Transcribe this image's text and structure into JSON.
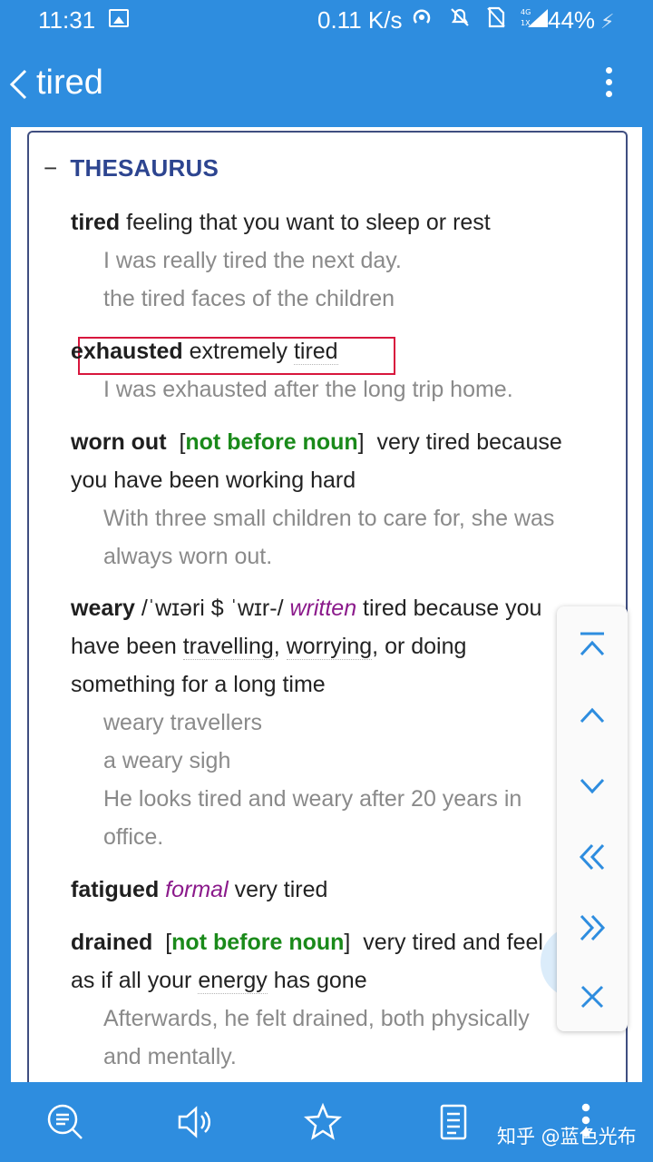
{
  "status": {
    "time": "11:31",
    "speed": "0.11 K/s",
    "battery": "44%"
  },
  "appbar": {
    "title": "tired"
  },
  "section": {
    "minus": "−",
    "title": "THESAURUS"
  },
  "entries": [
    {
      "headword": "tired",
      "definition": " feeling that you want to sleep or rest",
      "examples": [
        "I was really tired the next day.",
        "the tired faces of the children"
      ]
    },
    {
      "headword": "exhausted",
      "def_pre": " extremely ",
      "def_link": "tired",
      "examples": [
        "I was exhausted after the long trip home."
      ]
    },
    {
      "headword": "worn out",
      "grammar": "not before noun",
      "def_line1": "very tired because",
      "def_line2": "you have been working hard",
      "examples_lines": [
        "With three small children to care for, she was",
        "always worn out."
      ]
    },
    {
      "headword": "weary",
      "pron": " /ˈwɪəri $ ˈwɪr-/ ",
      "register": "written",
      "def_line1_rest": " tired because you",
      "link1": "travelling",
      "link2": "worrying",
      "def_line2_rest": ", or doing",
      "def_line3": "something for a long time",
      "examples_lines": [
        "weary travellers",
        "a weary sigh",
        "He looks tired and weary after 20 years in",
        "office."
      ]
    },
    {
      "headword": "fatigued",
      "register": "formal",
      "definition": " very tired"
    },
    {
      "headword": "drained",
      "grammar": "not before noun",
      "def_line1": "very tired and feel",
      "def_line2_pre": "as if all your ",
      "def_link": "energy",
      "def_line2_post": " has gone",
      "examples_lines": [
        "Afterwards, he felt drained, both physically",
        "and mentally."
      ]
    }
  ],
  "watermark": "知乎 @蓝色光布",
  "icons": {
    "back": "chevron-left-icon",
    "more": "more-vertical-icon",
    "nav": [
      "scroll-to-top-icon",
      "chevron-up-icon",
      "chevron-down-icon",
      "double-chevron-left-icon",
      "double-chevron-right-icon",
      "close-icon"
    ],
    "bottom": [
      "search-list-icon",
      "speaker-icon",
      "star-icon",
      "document-icon",
      "more-vertical-icon"
    ]
  },
  "colors": {
    "primary": "#2e8ddf",
    "section_head": "#2d4590",
    "grammar": "#1a8a1a",
    "register": "#8b1a8b",
    "example": "#8a8a8a",
    "highlight": "#d8163d"
  }
}
